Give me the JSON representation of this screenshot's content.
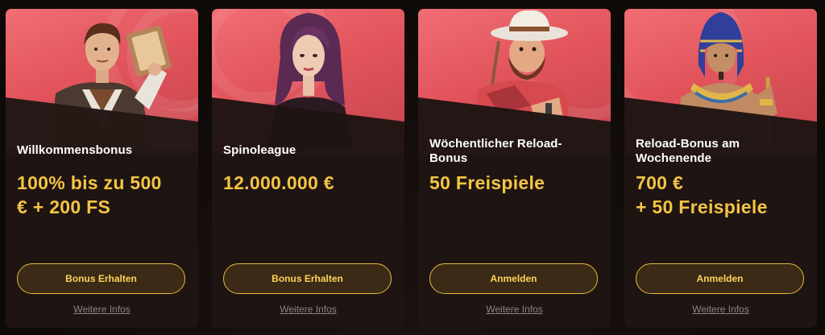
{
  "cards": [
    {
      "character": "adventurer-with-book-icon",
      "title": "Willkommensbonus",
      "amount_line1": "100% bis zu 500",
      "amount_line2": "€ + 200 FS",
      "button": "Bonus Erhalten",
      "more": "Weitere Infos"
    },
    {
      "character": "woman-portrait-icon",
      "title": "Spinoleague",
      "amount_line1": "12.000.000 €",
      "amount_line2": "",
      "button": "Bonus Erhalten",
      "more": "Weitere Infos"
    },
    {
      "character": "cowboy-fisherman-icon",
      "title_line1": "Wöchentlicher Reload-",
      "title_line2": "Bonus",
      "amount_line1": "50 Freispiele",
      "amount_line2": "",
      "button": "Anmelden",
      "more": "Weitere Infos"
    },
    {
      "character": "pharaoh-icon",
      "title_line1": "Reload-Bonus am",
      "title_line2": "Wochenende",
      "amount_line1": "700 €",
      "amount_line2": "+ 50 Freispiele",
      "button": "Anmelden",
      "more": "Weitere Infos"
    }
  ],
  "colors": {
    "card_top": "#e2545c",
    "card_body": "#1e1513",
    "amount": "#f5c542",
    "button_border": "#e6b93a",
    "button_text": "#ffd35a"
  }
}
